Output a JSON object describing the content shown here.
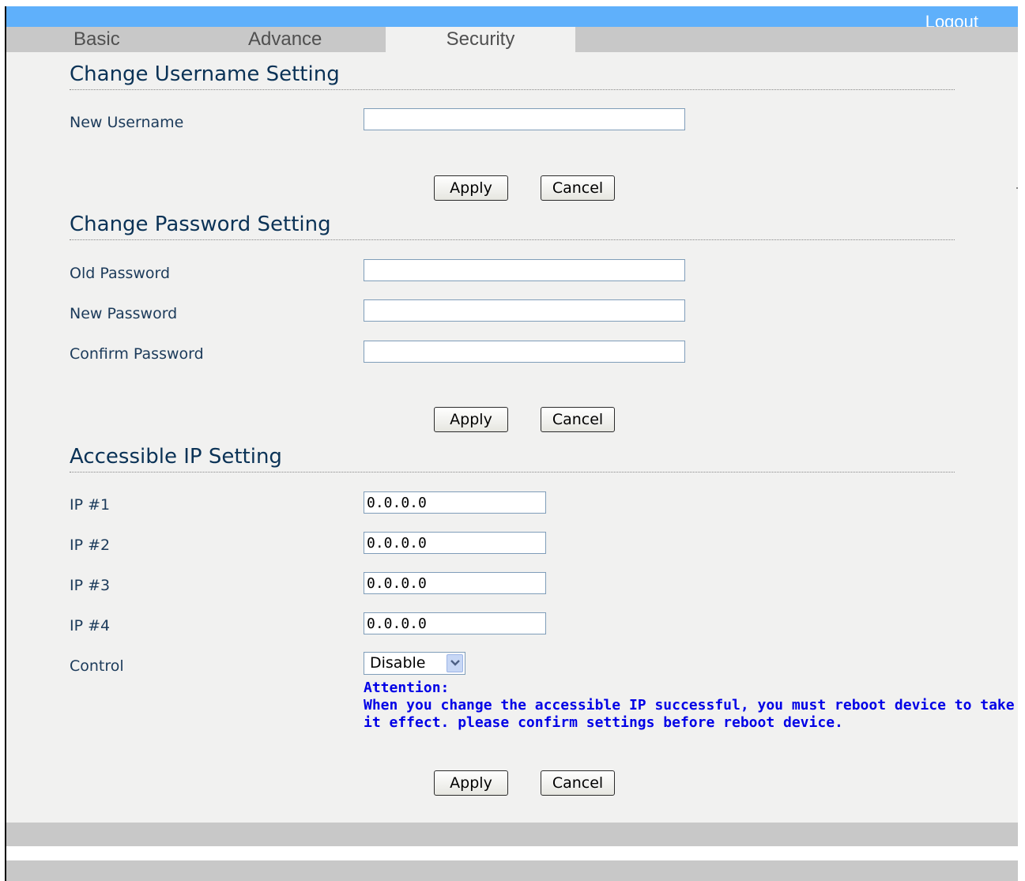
{
  "header": {
    "logout_label": "Logout"
  },
  "tabs": [
    {
      "label": "Basic"
    },
    {
      "label": "Advance"
    },
    {
      "label": "Security"
    }
  ],
  "username_section": {
    "title": "Change Username Setting",
    "new_username_label": "New Username",
    "new_username_value": ""
  },
  "password_section": {
    "title": "Change Password Setting",
    "old_password_label": "Old Password",
    "new_password_label": "New Password",
    "confirm_password_label": "Confirm Password",
    "old_password_value": "",
    "new_password_value": "",
    "confirm_password_value": ""
  },
  "ip_section": {
    "title": "Accessible IP Setting",
    "ips": [
      {
        "label": "IP #1",
        "value": "0.0.0.0"
      },
      {
        "label": "IP #2",
        "value": "0.0.0.0"
      },
      {
        "label": "IP #3",
        "value": "0.0.0.0"
      },
      {
        "label": "IP #4",
        "value": "0.0.0.0"
      }
    ],
    "control_label": "Control",
    "control_value": "Disable",
    "attention_title": "Attention:",
    "attention_text": "When you change the accessible IP successful, you must reboot device to take it effect. please confirm settings before reboot device."
  },
  "buttons": {
    "apply": "Apply",
    "cancel": "Cancel"
  },
  "colors": {
    "topbar": "#5fb0fb",
    "tabbar": "#c8c8c8",
    "content_bg": "#f1f1f0",
    "attention": "#0000e6"
  },
  "icons": {
    "control_dropdown": "chevron-down-icon"
  }
}
